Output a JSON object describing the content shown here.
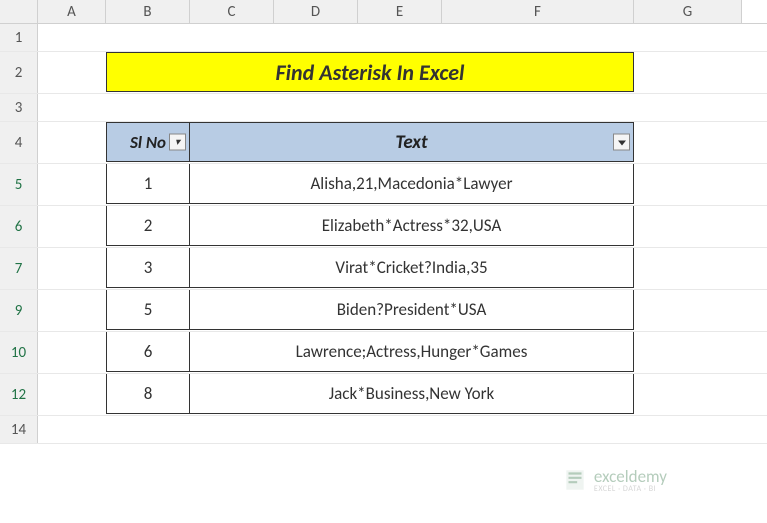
{
  "columns": [
    "A",
    "B",
    "C",
    "D",
    "E",
    "F",
    "G"
  ],
  "rows_visible": [
    "1",
    "2",
    "3",
    "4",
    "5",
    "6",
    "7",
    "9",
    "10",
    "12",
    "14"
  ],
  "title": "Find Asterisk In Excel",
  "headers": {
    "slno": "Sl No",
    "text": "Text"
  },
  "chart_data": {
    "type": "table",
    "title": "Find Asterisk In Excel",
    "columns": [
      "Sl No",
      "Text"
    ],
    "rows": [
      {
        "slno": "1",
        "text": "Alisha,21,Macedonia*Lawyer"
      },
      {
        "slno": "2",
        "text": "Elizabeth*Actress*32,USA"
      },
      {
        "slno": "3",
        "text": "Virat*Cricket?India,35"
      },
      {
        "slno": "5",
        "text": "Biden?President*USA"
      },
      {
        "slno": "6",
        "text": "Lawrence;Actress,Hunger*Games"
      },
      {
        "slno": "8",
        "text": "Jack*Business,New York"
      }
    ]
  },
  "watermark": {
    "main": "exceldemy",
    "sub": "EXCEL · DATA · BI"
  }
}
